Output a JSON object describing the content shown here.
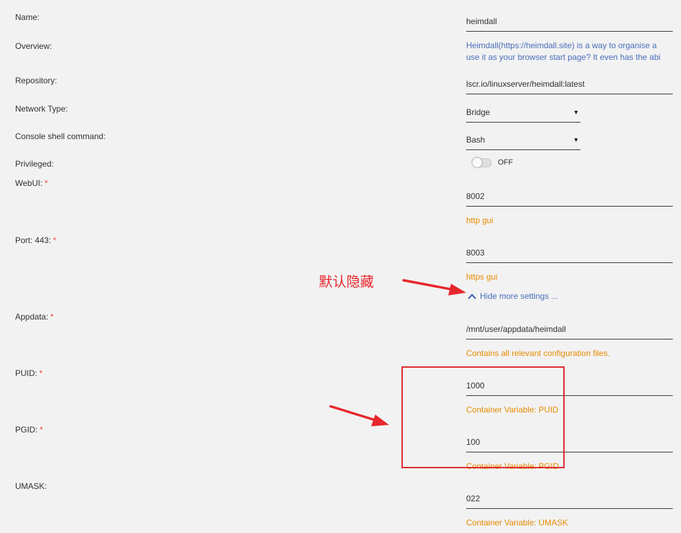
{
  "form": {
    "name": {
      "label": "Name:",
      "value": "heimdall"
    },
    "overview": {
      "label": "Overview:",
      "line1": "Heimdall(https://heimdall.site) is a way to organise a",
      "line2": "use it as your browser start page? It even has the abi"
    },
    "repository": {
      "label": "Repository:",
      "value": "lscr.io/linuxserver/heimdall:latest"
    },
    "network_type": {
      "label": "Network Type:",
      "value": "Bridge"
    },
    "console_shell": {
      "label": "Console shell command:",
      "value": "Bash"
    },
    "privileged": {
      "label": "Privileged:",
      "state": "OFF"
    },
    "webui": {
      "label": "WebUI:",
      "required": "*",
      "value": "8002",
      "hint": "http gui"
    },
    "port443": {
      "label": "Port: 443:",
      "required": "*",
      "value": "8003",
      "hint": "https gui"
    },
    "more_settings": {
      "label": "Hide more settings ..."
    },
    "appdata": {
      "label": "Appdata:",
      "required": "*",
      "value": "/mnt/user/appdata/heimdall",
      "hint": "Contains all relevant configuration files."
    },
    "puid": {
      "label": "PUID:",
      "required": "*",
      "value": "1000",
      "hint": "Container Variable: PUID"
    },
    "pgid": {
      "label": "PGID:",
      "required": "*",
      "value": "100",
      "hint": "Container Variable: PGID"
    },
    "umask": {
      "label": "UMASK:",
      "value": "022",
      "hint": "Container Variable: UMASK"
    }
  },
  "annotation": {
    "text": "默认隐藏",
    "color": "#e8262d"
  },
  "colors": {
    "background": "#f2f2f2",
    "link": "#486dba",
    "hint": "#e68a00",
    "required": "#ef3e42"
  }
}
